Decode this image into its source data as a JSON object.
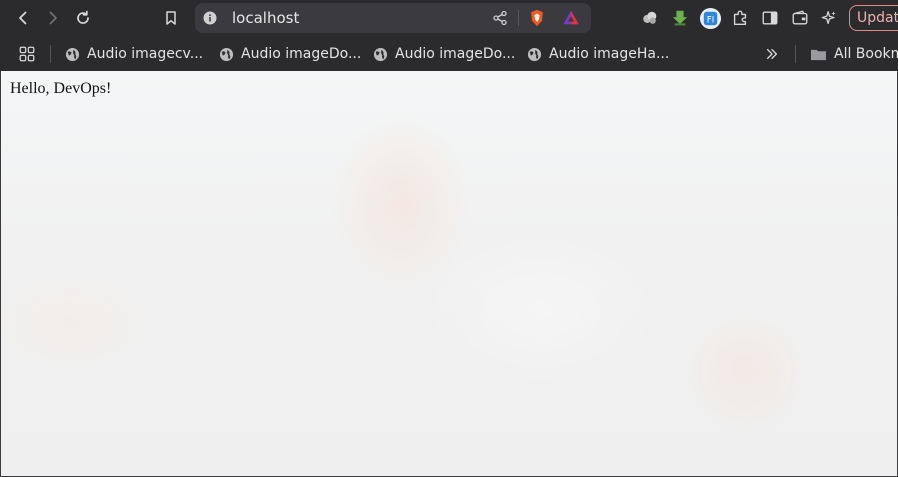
{
  "browser": {
    "url": "localhost",
    "update_label": "Updat",
    "colors": {
      "chrome_bg": "#2b2b2e",
      "urlbar_bg": "#3b3b3f",
      "update_border": "#e08b8b",
      "extension_green": "#6ab04c",
      "extension_blue": "#2f86d6"
    }
  },
  "bookmarks": {
    "items": [
      {
        "label": "Audio imagecv...",
        "icon": "globe-icon"
      },
      {
        "label": "Audio imageDo...",
        "icon": "globe-icon"
      },
      {
        "label": "Audio imageDo...",
        "icon": "globe-icon"
      },
      {
        "label": "Audio imageHa...",
        "icon": "globe-icon"
      }
    ],
    "all_bookmarks_label": "All Bookm"
  },
  "page": {
    "content_text": "Hello, DevOps!"
  },
  "icons": [
    "back-icon",
    "forward-icon",
    "reload-icon",
    "bookmark-icon",
    "info-icon",
    "share-icon",
    "brave-shields-icon",
    "brave-rewards-icon",
    "extension-cloud-icon",
    "extension-download-icon",
    "extension-fi-icon",
    "extensions-puzzle-icon",
    "sidebar-icon",
    "wallet-icon",
    "leo-ai-icon",
    "apps-grid-icon",
    "chevron-double-right-icon",
    "folder-icon"
  ]
}
